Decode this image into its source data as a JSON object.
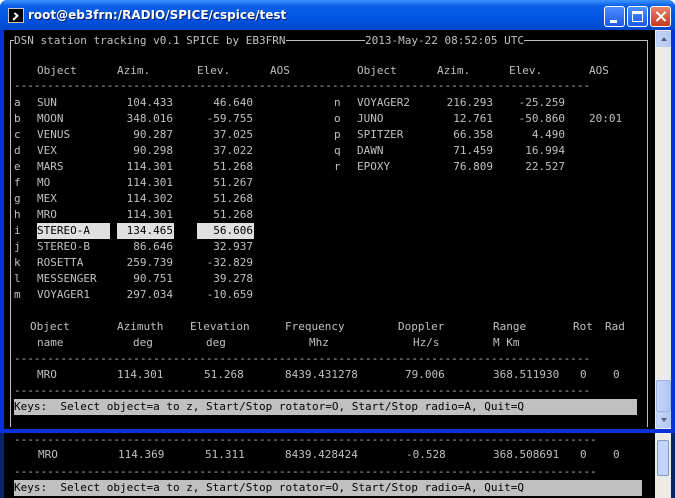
{
  "window": {
    "title": "root@eb3frn:/RADIO/SPICE/cspice/test"
  },
  "header": {
    "title": "DSN station tracking v0.1 SPICE by EB3FRN",
    "datetime": "2013-May-22 08:52:05 UTC"
  },
  "table_columns": {
    "object": "Object",
    "azim": "Azim.",
    "elev": "Elev.",
    "aos": "AOS"
  },
  "left_rows": [
    {
      "key": "a",
      "name": "SUN",
      "azim": "104.433",
      "elev": "46.640",
      "aos": ""
    },
    {
      "key": "b",
      "name": "MOON",
      "azim": "348.016",
      "elev": "-59.755",
      "aos": ""
    },
    {
      "key": "c",
      "name": "VENUS",
      "azim": "90.287",
      "elev": "37.025",
      "aos": ""
    },
    {
      "key": "d",
      "name": "VEX",
      "azim": "90.298",
      "elev": "37.022",
      "aos": ""
    },
    {
      "key": "e",
      "name": "MARS",
      "azim": "114.301",
      "elev": "51.268",
      "aos": ""
    },
    {
      "key": "f",
      "name": "MO",
      "azim": "114.301",
      "elev": "51.267",
      "aos": ""
    },
    {
      "key": "g",
      "name": "MEX",
      "azim": "114.302",
      "elev": "51.268",
      "aos": ""
    },
    {
      "key": "h",
      "name": "MRO",
      "azim": "114.301",
      "elev": "51.268",
      "aos": ""
    },
    {
      "key": "i",
      "name": "STEREO-A",
      "azim": "134.465",
      "elev": "56.606",
      "aos": "",
      "selected": true
    },
    {
      "key": "j",
      "name": "STEREO-B",
      "azim": "86.646",
      "elev": "32.937",
      "aos": ""
    },
    {
      "key": "k",
      "name": "ROSETTA",
      "azim": "259.739",
      "elev": "-32.829",
      "aos": ""
    },
    {
      "key": "l",
      "name": "MESSENGER",
      "azim": "90.751",
      "elev": "39.278",
      "aos": ""
    },
    {
      "key": "m",
      "name": "VOYAGER1",
      "azim": "297.034",
      "elev": "-10.659",
      "aos": ""
    }
  ],
  "right_rows": [
    {
      "key": "n",
      "name": "VOYAGER2",
      "azim": "216.293",
      "elev": "-25.259",
      "aos": ""
    },
    {
      "key": "o",
      "name": "JUNO",
      "azim": "12.761",
      "elev": "-50.860",
      "aos": "20:01"
    },
    {
      "key": "p",
      "name": "SPITZER",
      "azim": "66.358",
      "elev": "4.490",
      "aos": ""
    },
    {
      "key": "q",
      "name": "DAWN",
      "azim": "71.459",
      "elev": "16.994",
      "aos": ""
    },
    {
      "key": "r",
      "name": "EPOXY",
      "azim": "76.809",
      "elev": "22.527",
      "aos": ""
    }
  ],
  "detail_columns": {
    "object": "Object",
    "object_unit": "name",
    "azimuth": "Azimuth",
    "azimuth_unit": "deg",
    "elevation": "Elevation",
    "elevation_unit": "deg",
    "frequency": "Frequency",
    "frequency_unit": "Mhz",
    "doppler": "Doppler",
    "doppler_unit": "Hz/s",
    "range": "Range",
    "range_unit": "M Km",
    "rot": "Rot",
    "rad": "Rad"
  },
  "detail_row": {
    "name": "MRO",
    "azimuth": "114.301",
    "elevation": "51.268",
    "frequency": "8439.431278",
    "doppler": "79.006",
    "range": "368.511930",
    "rot": "0",
    "rad": "0"
  },
  "keys_text": "Keys:  Select object=a to z, Start/Stop rotator=O, Start/Stop radio=A, Quit=Q",
  "background_window": {
    "detail_row": {
      "name": "MRO",
      "azimuth": "114.369",
      "elevation": "51.311",
      "frequency": "8439.428424",
      "doppler": "-0.528",
      "range": "368.508691",
      "rot": "0",
      "rad": "0"
    },
    "keys_text": "Keys:  Select object=a to z, Start/Stop rotator=O, Start/Stop radio=A, Quit=Q"
  },
  "colors": {
    "titlebar": "#0054e3",
    "terminal_bg": "#000000",
    "terminal_fg": "#c0c0c0",
    "highlight_bg": "#e0e0e0"
  }
}
